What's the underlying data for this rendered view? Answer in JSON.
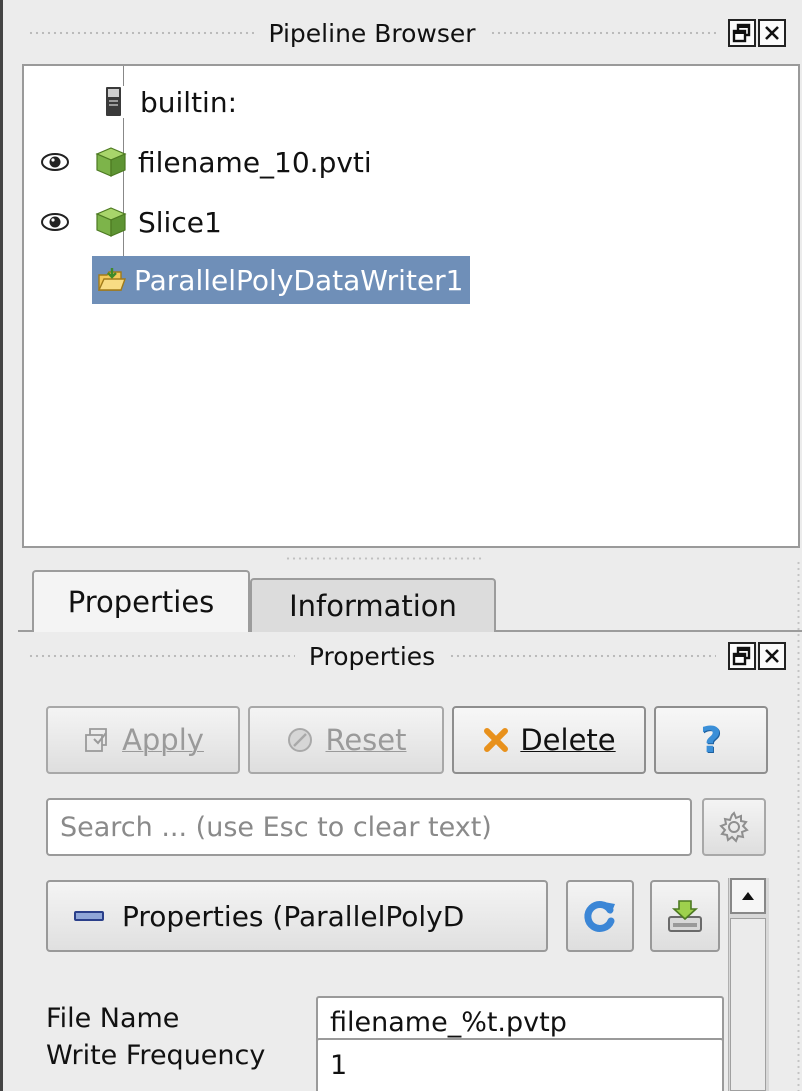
{
  "pipeline_browser": {
    "title": "Pipeline Browser",
    "items": [
      {
        "label": "builtin:",
        "icon": "server-icon",
        "visible_eye": false
      },
      {
        "label": "filename_10.pvti",
        "icon": "green-cube-icon",
        "visible_eye": true
      },
      {
        "label": "Slice1",
        "icon": "green-cube-icon",
        "visible_eye": true
      },
      {
        "label": "ParallelPolyDataWriter1",
        "icon": "writer-folder-icon",
        "visible_eye": false,
        "selected": true
      }
    ]
  },
  "tabs": {
    "properties": "Properties",
    "information": "Information"
  },
  "properties_panel": {
    "title": "Properties",
    "apply_label": "Apply",
    "reset_label": "Reset",
    "delete_label": "Delete",
    "help_label": "?",
    "search_placeholder": "Search ... (use Esc to clear text)",
    "section_label": "Properties (ParallelPolyD",
    "fields": {
      "file_name_label": "File Name",
      "file_name_value": "filename_%t.pvtp",
      "write_frequency_label": "Write Frequency",
      "write_frequency_value": "1"
    }
  },
  "colors": {
    "selection": "#6f8fb8",
    "cube_green": "#7db44a",
    "delete_orange": "#e8911c",
    "help_blue": "#3a8fd8",
    "refresh_blue": "#3b86d6"
  }
}
